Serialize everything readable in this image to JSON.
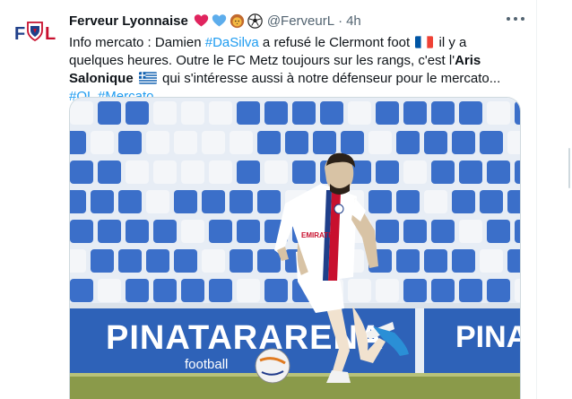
{
  "tweet": {
    "author_name": "Ferveur Lyonnaise",
    "name_emojis": [
      "red-heart-emoji",
      "blue-heart-emoji",
      "lion-emoji",
      "soccer-ball-emoji"
    ],
    "handle": "@FerveurL",
    "separator": "·",
    "time": "4h",
    "body": {
      "line1_prefix": "Info mercato : Damien ",
      "hashtag_dasilva": "#DaSilva",
      "line1_mid": " a refusé le Clermont foot ",
      "flag_france": "flag-france",
      "line1_suffix": " il y a quelques heures. Outre le FC Metz toujours sur les rangs, c'est l'",
      "aris_bold": "Aris Salonique",
      "flag_greece": "flag-greece",
      "line3_text": " qui s'intéresse aussi à notre défenseur pour le mercato... ",
      "hashtag_ol": "#OL",
      "hashtag_mercato": "#Mercato"
    }
  },
  "logo": {
    "text": "FOL"
  },
  "media": {
    "banner_text": "PINATARARENA",
    "banner_sub": "football",
    "banner_right_text": "PINA",
    "shirt_sponsor": "EMIRATES"
  },
  "colors": {
    "accent": "#1d9bf0",
    "secondary_text": "#536471",
    "stadium_seat_blue": "#3b6fc9",
    "banner_blue": "#2e62b8"
  }
}
